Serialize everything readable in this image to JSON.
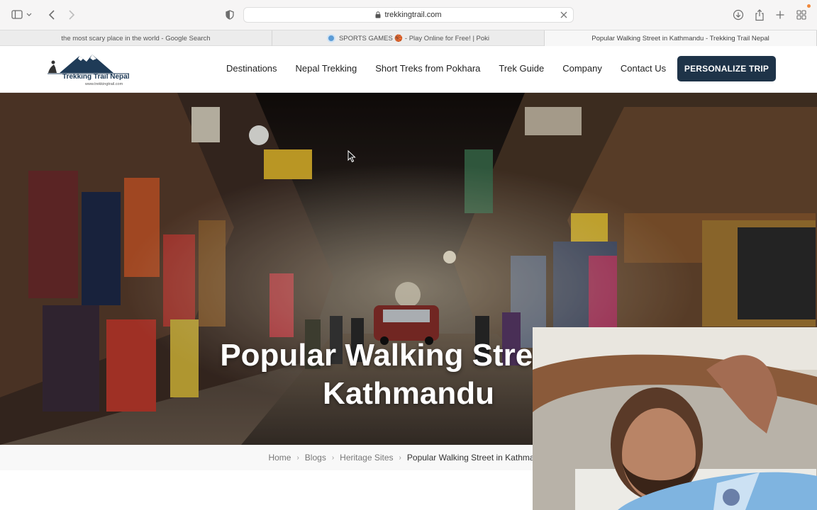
{
  "browser": {
    "address": "trekkingtrail.com",
    "tabs": [
      {
        "label": "the most scary place in the world - Google Search",
        "active": false
      },
      {
        "label": "SPORTS GAMES 🏀 - Play Online for Free! | Poki",
        "active": false
      },
      {
        "label": "Popular Walking Street in Kathmandu - Trekking Trail Nepal",
        "active": true
      }
    ]
  },
  "site": {
    "logo_text": "Trekking Trail Nepal",
    "logo_url": "www.trekkingtrail.com",
    "nav": [
      "Destinations",
      "Nepal Trekking",
      "Short Treks from Pokhara",
      "Trek Guide",
      "Company",
      "Contact Us"
    ],
    "cta_label": "PERSONALIZE TRIP",
    "cta_color": "#1e3348"
  },
  "hero": {
    "title_line1": "Popular Walking Street in",
    "title_line2": "Kathmandu"
  },
  "breadcrumb": {
    "home": "Home",
    "blogs": "Blogs",
    "category": "Heritage Sites",
    "current": "Popular Walking Street in Kathmandu"
  },
  "icons": {
    "sidebar": "sidebar-icon",
    "back": "chevron-left-icon",
    "forward": "chevron-right-icon",
    "shield": "shield-icon",
    "lock": "lock-icon",
    "download": "download-icon",
    "share": "share-icon",
    "new_tab": "plus-icon",
    "tab_overview": "grid-icon"
  }
}
